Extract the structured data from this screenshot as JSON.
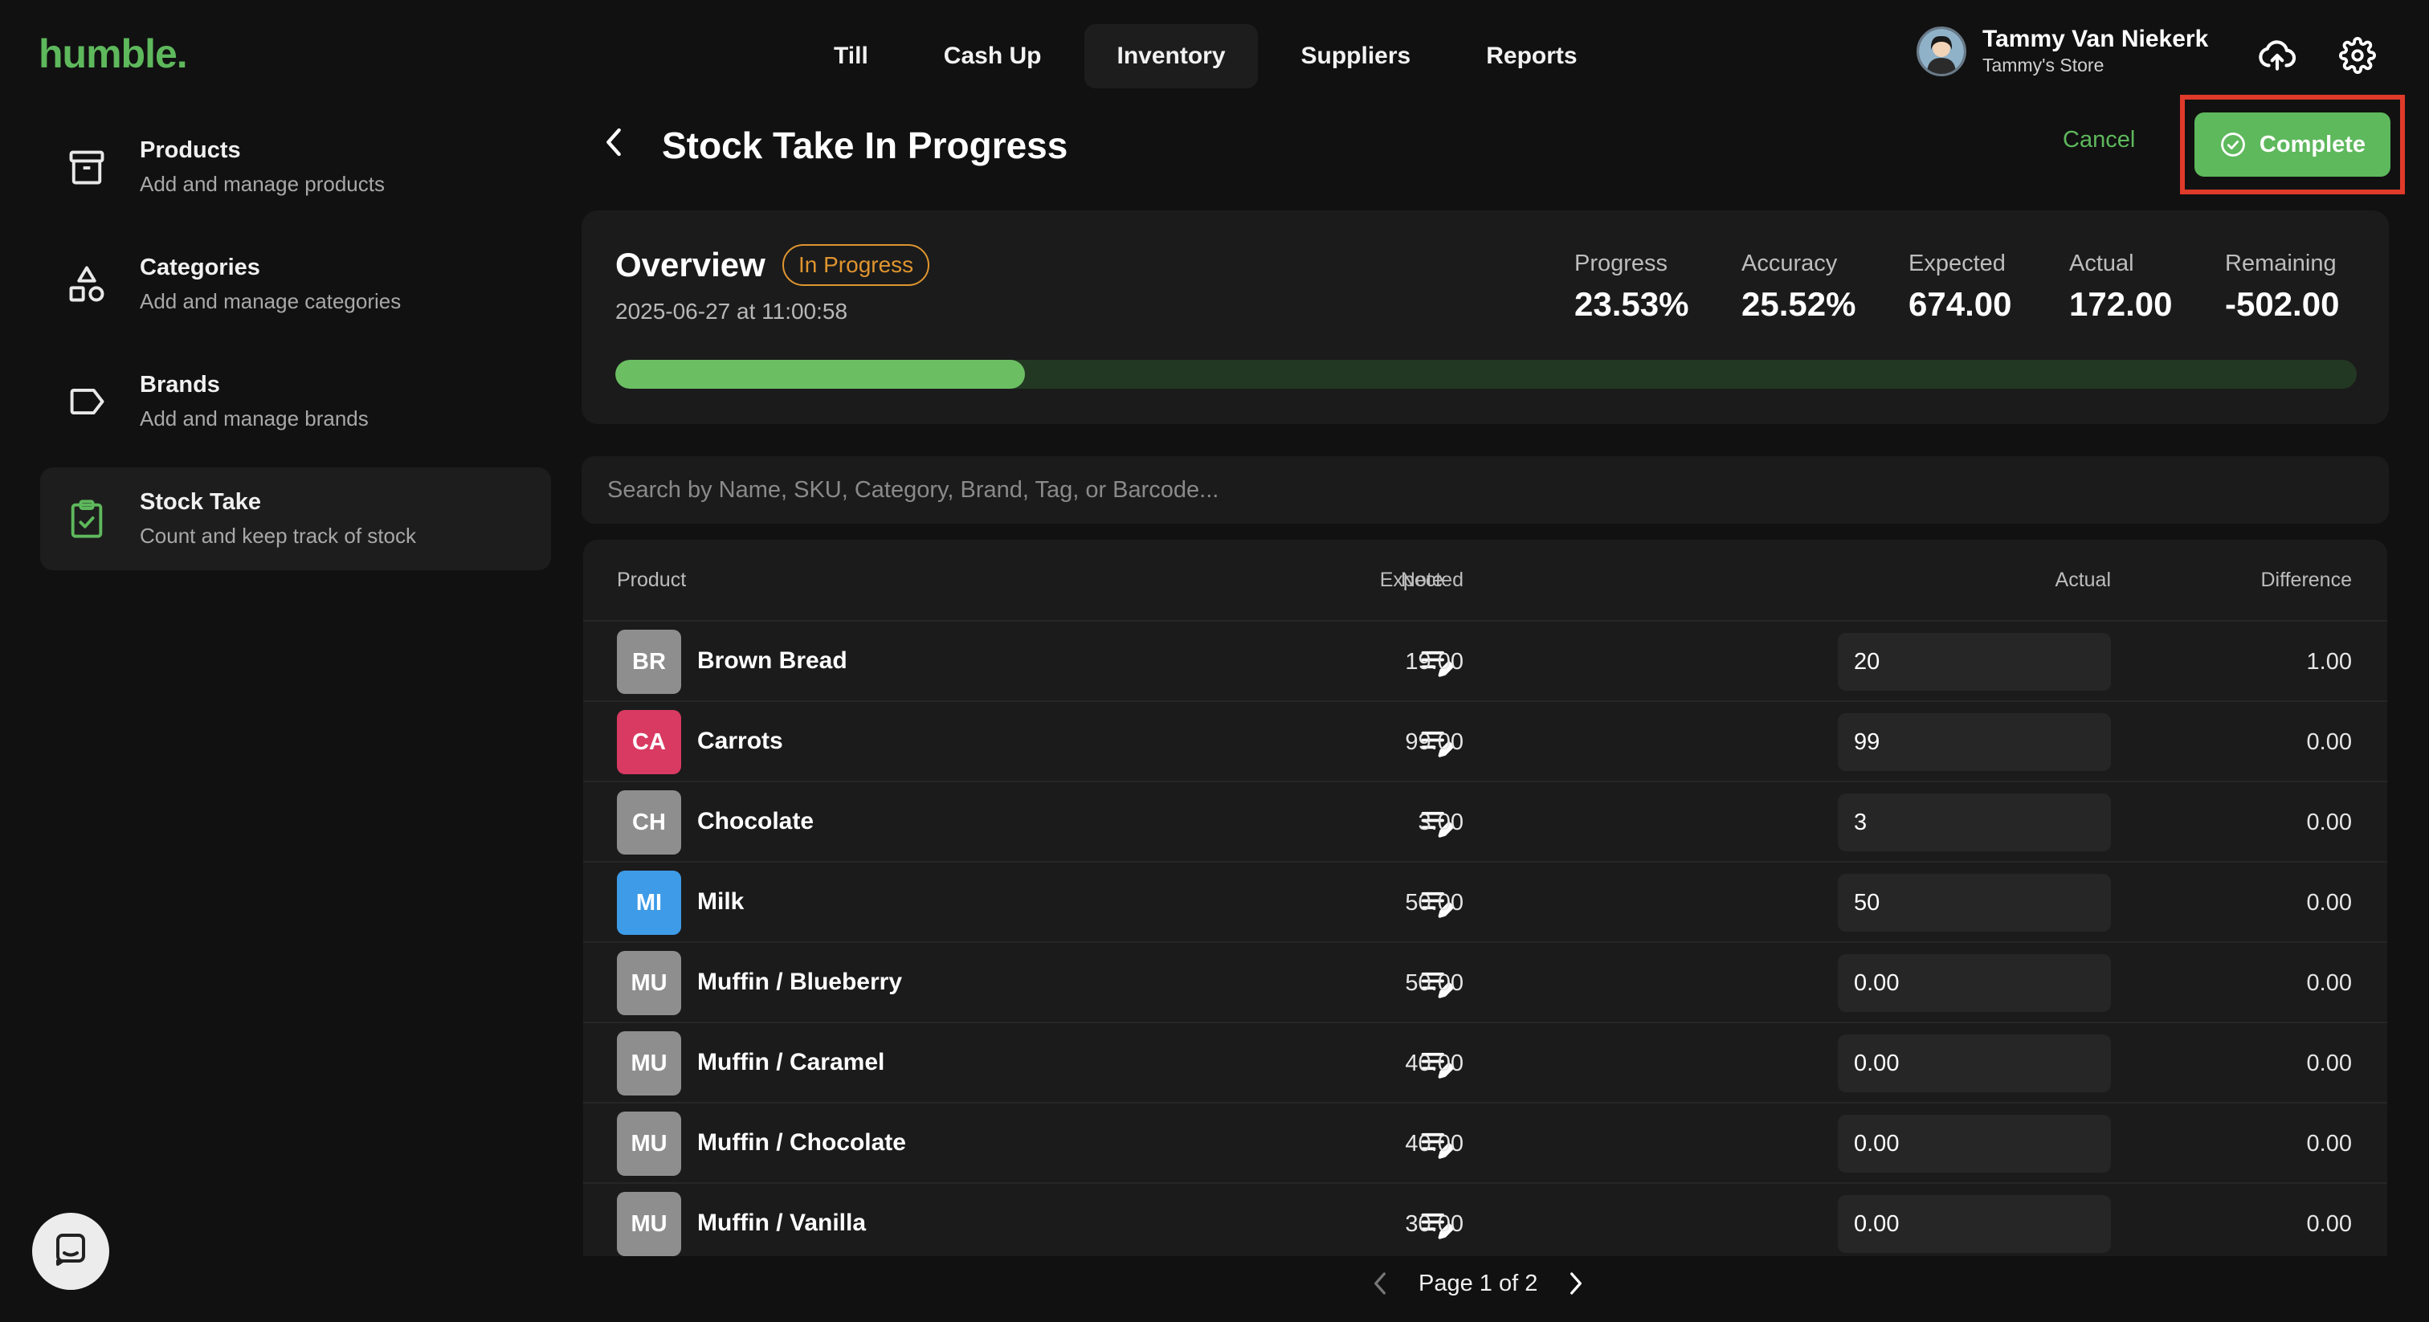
{
  "app": {
    "logo": "humble."
  },
  "nav": {
    "tabs": [
      {
        "label": "Till",
        "active": false
      },
      {
        "label": "Cash Up",
        "active": false
      },
      {
        "label": "Inventory",
        "active": true
      },
      {
        "label": "Suppliers",
        "active": false
      },
      {
        "label": "Reports",
        "active": false
      }
    ]
  },
  "user": {
    "name": "Tammy Van Niekerk",
    "store": "Tammy's Store"
  },
  "icons": {
    "upload": "cloud-upload-icon",
    "settings": "gear-icon",
    "back": "chevron-left-icon",
    "note": "edit-note-icon",
    "chat": "chat-icon",
    "complete": "check-circle-icon"
  },
  "sidebar": {
    "items": [
      {
        "title": "Products",
        "subtitle": "Add and manage products",
        "icon": "archive-box-icon",
        "active": false
      },
      {
        "title": "Categories",
        "subtitle": "Add and manage categories",
        "icon": "shapes-icon",
        "active": false
      },
      {
        "title": "Brands",
        "subtitle": "Add and manage brands",
        "icon": "tag-icon",
        "active": false
      },
      {
        "title": "Stock Take",
        "subtitle": "Count and keep track of stock",
        "icon": "clipboard-check-icon",
        "active": true
      }
    ]
  },
  "header": {
    "title": "Stock Take In Progress",
    "cancel_label": "Cancel",
    "complete_label": "Complete"
  },
  "overview": {
    "title": "Overview",
    "status": "In Progress",
    "date": "2025-06-27 at 11:00:58",
    "progress_fraction": 0.2353,
    "stats": [
      {
        "label": "Progress",
        "value": "23.53%"
      },
      {
        "label": "Accuracy",
        "value": "25.52%"
      },
      {
        "label": "Expected",
        "value": "674.00"
      },
      {
        "label": "Actual",
        "value": "172.00"
      },
      {
        "label": "Remaining",
        "value": "-502.00"
      }
    ]
  },
  "search": {
    "placeholder": "Search by Name, SKU, Category, Brand, Tag, or Barcode..."
  },
  "table": {
    "columns": {
      "product": "Product",
      "note": "Note",
      "expected": "Expected",
      "actual": "Actual",
      "difference": "Difference"
    },
    "rows": [
      {
        "initials": "BR",
        "color": "#8e8e8e",
        "name": "Brown Bread",
        "expected": "19.00",
        "actual": "20",
        "difference": "1.00"
      },
      {
        "initials": "CA",
        "color": "#d93a62",
        "name": "Carrots",
        "expected": "99.00",
        "actual": "99",
        "difference": "0.00"
      },
      {
        "initials": "CH",
        "color": "#8e8e8e",
        "name": "Chocolate",
        "expected": "3.00",
        "actual": "3",
        "difference": "0.00"
      },
      {
        "initials": "MI",
        "color": "#3d9be8",
        "name": "Milk",
        "expected": "50.00",
        "actual": "50",
        "difference": "0.00"
      },
      {
        "initials": "MU",
        "color": "#8e8e8e",
        "name": "Muffin / Blueberry",
        "expected": "50.00",
        "actual": "0.00",
        "difference": "0.00"
      },
      {
        "initials": "MU",
        "color": "#8e8e8e",
        "name": "Muffin / Caramel",
        "expected": "40.00",
        "actual": "0.00",
        "difference": "0.00"
      },
      {
        "initials": "MU",
        "color": "#8e8e8e",
        "name": "Muffin / Chocolate",
        "expected": "40.00",
        "actual": "0.00",
        "difference": "0.00"
      },
      {
        "initials": "MU",
        "color": "#8e8e8e",
        "name": "Muffin / Vanilla",
        "expected": "30.00",
        "actual": "0.00",
        "difference": "0.00"
      }
    ]
  },
  "pagination": {
    "label": "Page 1 of 2"
  },
  "colors": {
    "accent": "#5eb85c",
    "status": "#e0952f",
    "highlight": "#e03a2a"
  }
}
